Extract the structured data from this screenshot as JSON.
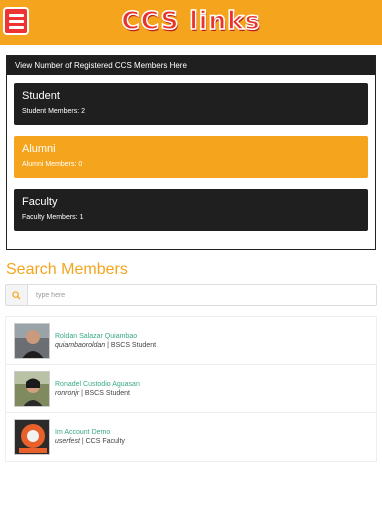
{
  "header": {
    "logo_text": "CCS links",
    "colors": {
      "bar": "#f5a51d",
      "logo": "#e8332a",
      "menu_button": "#e33333"
    }
  },
  "panel": {
    "title": "View Number of Registered CCS Members Here",
    "cards": [
      {
        "title": "Student",
        "subtitle": "Student Members: 2",
        "color": "#1f1f1f"
      },
      {
        "title": "Alumni",
        "subtitle": "Alumni Members: 0",
        "color": "#f5a51d"
      },
      {
        "title": "Faculty",
        "subtitle": "Faculty Members: 1",
        "color": "#1f1f1f"
      }
    ]
  },
  "search": {
    "title": "Search Members",
    "placeholder": "type here",
    "icon": "search-icon"
  },
  "members": [
    {
      "name": "Roldan Salazar Quiambao",
      "username": "quiambaoroldan",
      "role": "BSCS Student"
    },
    {
      "name": "Ronadel Custodio Aguasan",
      "username": "ronronjr",
      "role": "BSCS Student"
    },
    {
      "name": "Im Account Demo",
      "username": "userfest",
      "role": "CCS Faculty"
    }
  ]
}
